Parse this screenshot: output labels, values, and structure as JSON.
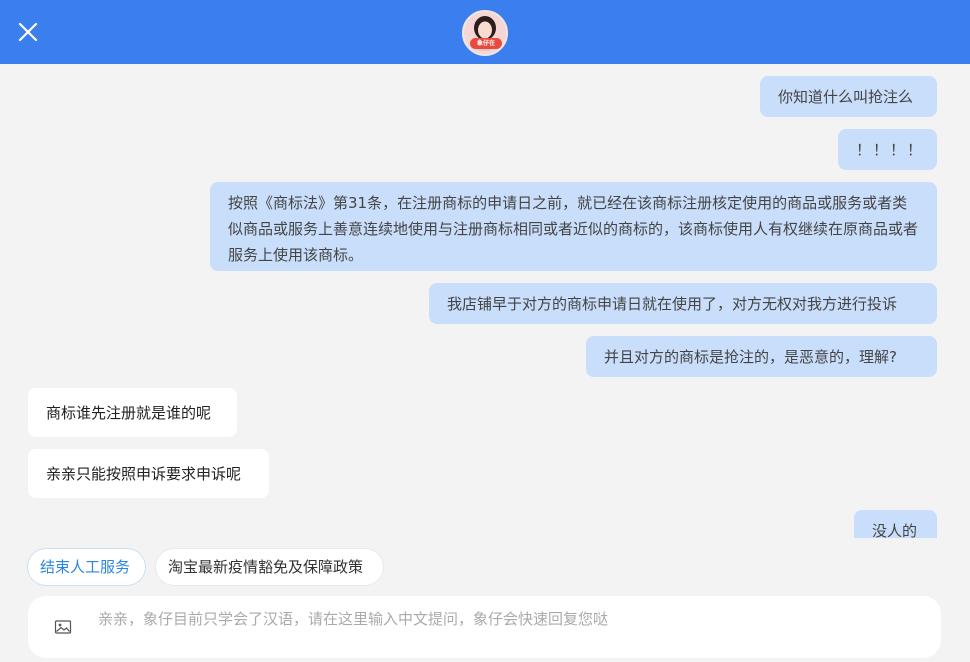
{
  "header": {
    "avatar_badge": "象仔在"
  },
  "messages": [
    {
      "role": "user",
      "text": "你知道什么叫抢注么"
    },
    {
      "role": "user",
      "text": "！！！！"
    },
    {
      "role": "user",
      "text": "按照《商标法》第31条，在注册商标的申请日之前，就已经在该商标注册核定使用的商品或服务或者类似商品或服务上善意连续地使用与注册商标相同或者近似的商标的，该商标使用人有权继续在原商品或者服务上使用该商标。"
    },
    {
      "role": "user",
      "text": "我店铺早于对方的商标申请日就在使用了，对方无权对我方进行投诉"
    },
    {
      "role": "user",
      "text": "并且对方的商标是抢注的，是恶意的，理解?"
    },
    {
      "role": "agent",
      "text": "商标谁先注册就是谁的呢"
    },
    {
      "role": "agent",
      "text": "亲亲只能按照申诉要求申诉呢"
    },
    {
      "role": "user",
      "text": "没人的"
    }
  ],
  "quick_replies": [
    {
      "label": "结束人工服务"
    },
    {
      "label": "淘宝最新疫情豁免及保障政策"
    }
  ],
  "input": {
    "placeholder": "亲亲，象仔目前只学会了汉语，请在这里输入中文提问，象仔会快速回复您哒",
    "value": ""
  },
  "colors": {
    "header_bg": "#3b7fee",
    "user_bubble": "#c9defb",
    "agent_bubble": "#ffffff",
    "page_bg": "#f3f3f3",
    "quick_primary_text": "#2b86e0"
  }
}
